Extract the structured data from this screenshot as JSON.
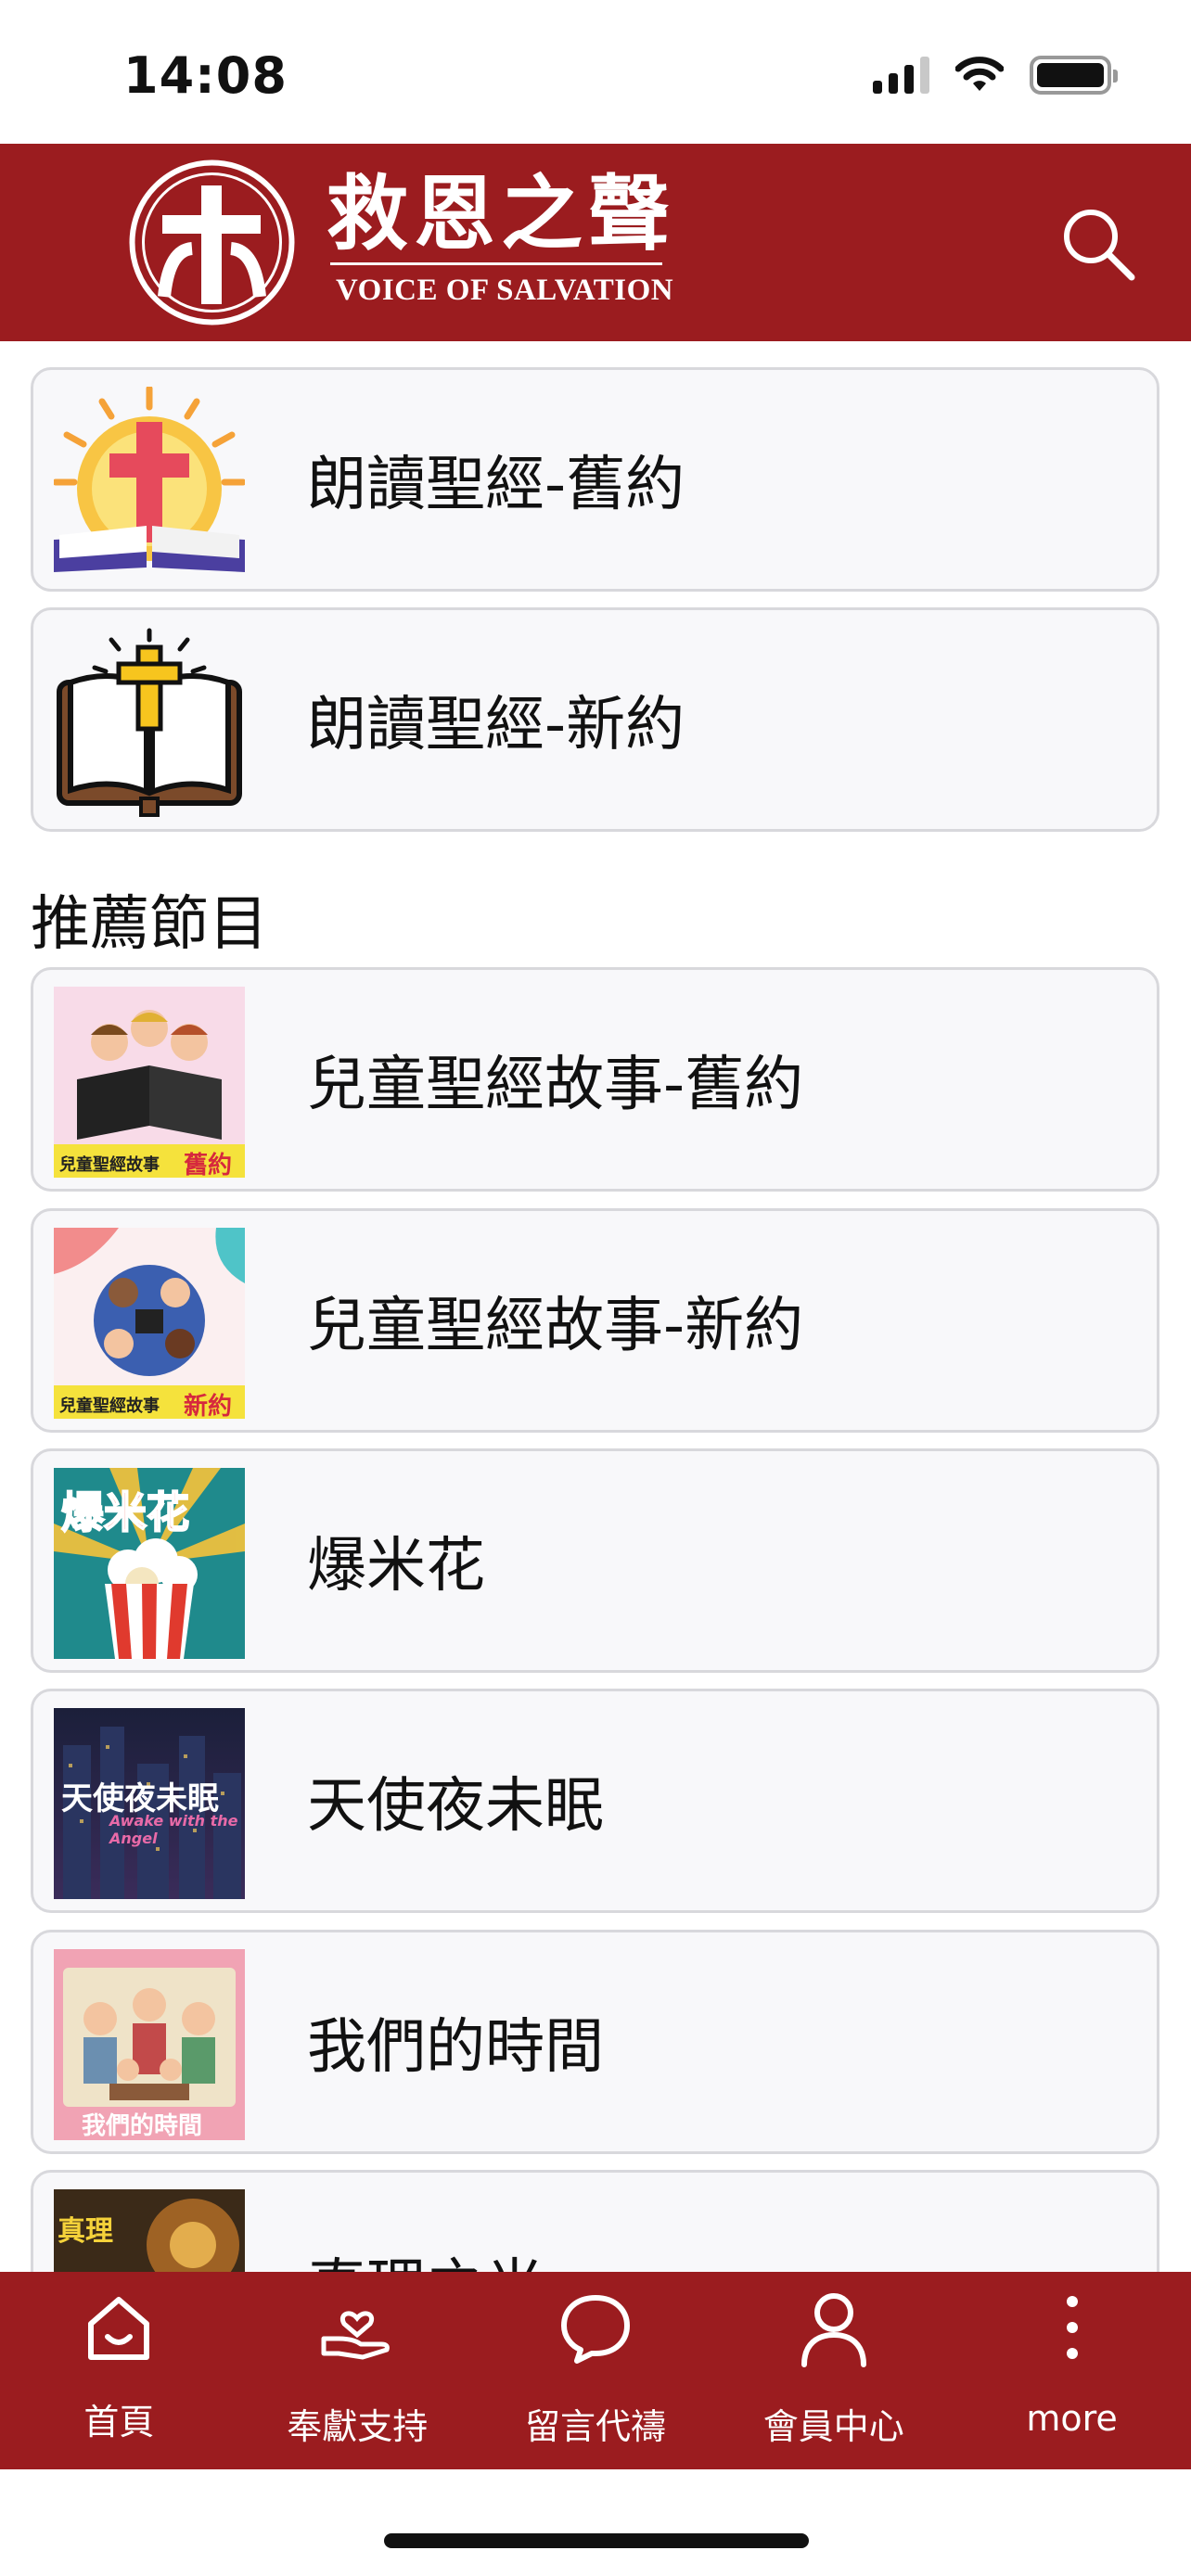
{
  "status_bar": {
    "time": "14:08"
  },
  "header": {
    "brand_cn": "救恩之聲",
    "brand_en": "VOICE OF SALVATION"
  },
  "quick_links": [
    {
      "title": "朗讀聖經-舊約",
      "icon": "bible-sunrise-cross-icon"
    },
    {
      "title": "朗讀聖經-新約",
      "icon": "open-bible-cross-icon"
    }
  ],
  "section_title": "推薦節目",
  "programs": [
    {
      "title": "兒童聖經故事-舊約",
      "thumb_caption": "兒童聖經故事",
      "thumb_tag": "舊約"
    },
    {
      "title": "兒童聖經故事-新約",
      "thumb_caption": "兒童聖經故事",
      "thumb_tag": "新約"
    },
    {
      "title": "爆米花",
      "thumb_caption": "爆米花"
    },
    {
      "title": "天使夜未眠",
      "thumb_caption": "天使夜未眠",
      "thumb_sub": "Awake with the Angel"
    },
    {
      "title": "我們的時間",
      "thumb_caption": "我們的時間"
    },
    {
      "title": "真理之光",
      "thumb_caption": "真理"
    }
  ],
  "tabbar": [
    {
      "label": "首頁",
      "icon": "home-icon"
    },
    {
      "label": "奉獻支持",
      "icon": "donate-hand-heart-icon"
    },
    {
      "label": "留言代禱",
      "icon": "chat-bubble-icon"
    },
    {
      "label": "會員中心",
      "icon": "user-icon"
    },
    {
      "label": "more",
      "icon": "more-vertical-icon"
    }
  ],
  "colors": {
    "brand_red": "#9b1c1f",
    "card_bg": "#f8f8fa",
    "card_border": "#d8d8dc"
  }
}
